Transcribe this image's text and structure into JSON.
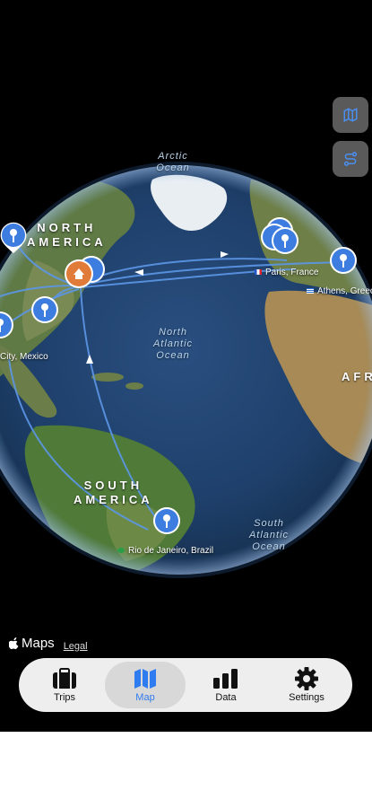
{
  "map": {
    "regions": {
      "north_america": [
        "NORTH",
        "AMERICA"
      ],
      "south_america": [
        "SOUTH",
        "AMERICA"
      ],
      "africa": "AFR"
    },
    "oceans": {
      "arctic": [
        "Arctic",
        "Ocean"
      ],
      "north_atlantic": [
        "North",
        "Atlantic",
        "Ocean"
      ],
      "south_atlantic": [
        "South",
        "Atlantic",
        "Ocean"
      ]
    },
    "cities": {
      "paris": "Paris, France",
      "athens": "Athens, Greece",
      "mexico": "City, Mexico",
      "rio": "Rio de Janeiro, Brazil"
    },
    "controls": {
      "map_style_icon": "map-icon",
      "routes_icon": "route-icon"
    },
    "attribution": {
      "brand": "Maps",
      "legal": "Legal"
    }
  },
  "tabs": [
    {
      "label": "Trips",
      "icon": "suitcase-icon"
    },
    {
      "label": "Map",
      "icon": "map-icon",
      "active": true
    },
    {
      "label": "Data",
      "icon": "bar-chart-icon"
    },
    {
      "label": "Settings",
      "icon": "gear-icon"
    }
  ],
  "colors": {
    "accent": "#2f7cf0",
    "pin_blue": "#3d7de0",
    "home_orange": "#e07b39",
    "route_line": "#5c97e8"
  }
}
